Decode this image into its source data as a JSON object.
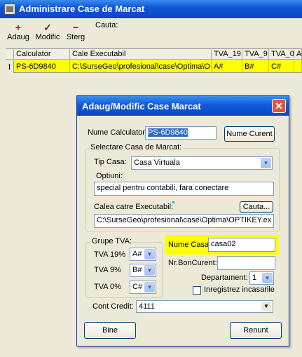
{
  "window": {
    "title": "Administrare Case de Marcat"
  },
  "toolbar": {
    "add": {
      "glyph": "+",
      "label": "Adaug"
    },
    "edit": {
      "glyph": "✓",
      "label": "Modific"
    },
    "delete": {
      "glyph": "−",
      "label": "Sterg"
    },
    "search_label": "Cauta:"
  },
  "grid": {
    "headers": [
      "Calculator",
      "Cale Executabil",
      "TVA_19",
      "TVA_9",
      "TVA_0",
      "A"
    ],
    "row_indicator": "I",
    "row": [
      "PS-6D9840",
      "C:\\SurseGeo\\profesional\\case\\Optima\\O",
      "A#",
      "B#",
      "C#",
      ""
    ]
  },
  "dialog": {
    "title": "Adaug/Modific Case Marcat",
    "close_glyph": "✕",
    "nume_calculator_label": "Nume Calculator:",
    "nume_calculator_value": "PS-6D9840",
    "nume_curent_button": "Nume Curent",
    "selectare_group": "Selectare Casa de Marcat:",
    "tip_casa_label": "Tip Casa:",
    "tip_casa_value": "Casa Virtuala",
    "optiuni_label": "Optiuni:",
    "optiuni_value": "special pentru contabili, fara conectare",
    "calea_label": "Calea catre Executabil:",
    "cauta_button": "Cauta...",
    "calea_value": "C:\\SurseGeo\\profesional\\case\\Optima\\OPTIKEY.ex",
    "grupe_tva_group": "Grupe TVA:",
    "tva19_label": "TVA 19%",
    "tva19_value": "A#",
    "tva9_label": "TVA 9%",
    "tva9_value": "B#",
    "tva0_label": "TVA 0%",
    "tva0_value": "C#",
    "nume_casa_label": "Nume Casa:",
    "nume_casa_value": "casa02",
    "nr_bon_label": "Nr.BonCurent:",
    "nr_bon_value": "",
    "departament_label": "Departament:",
    "departament_value": "1",
    "inregistrez_label": "Inregistrez incasarile",
    "cont_credit_label": "Cont Credit:",
    "cont_credit_value": "4111",
    "bine_button": "Bine",
    "renunt_button": "Renunt"
  },
  "colors": {
    "highlight": "#ffff00",
    "title_bar": "#0a46c4",
    "accent_dot": "#00c0c0"
  }
}
